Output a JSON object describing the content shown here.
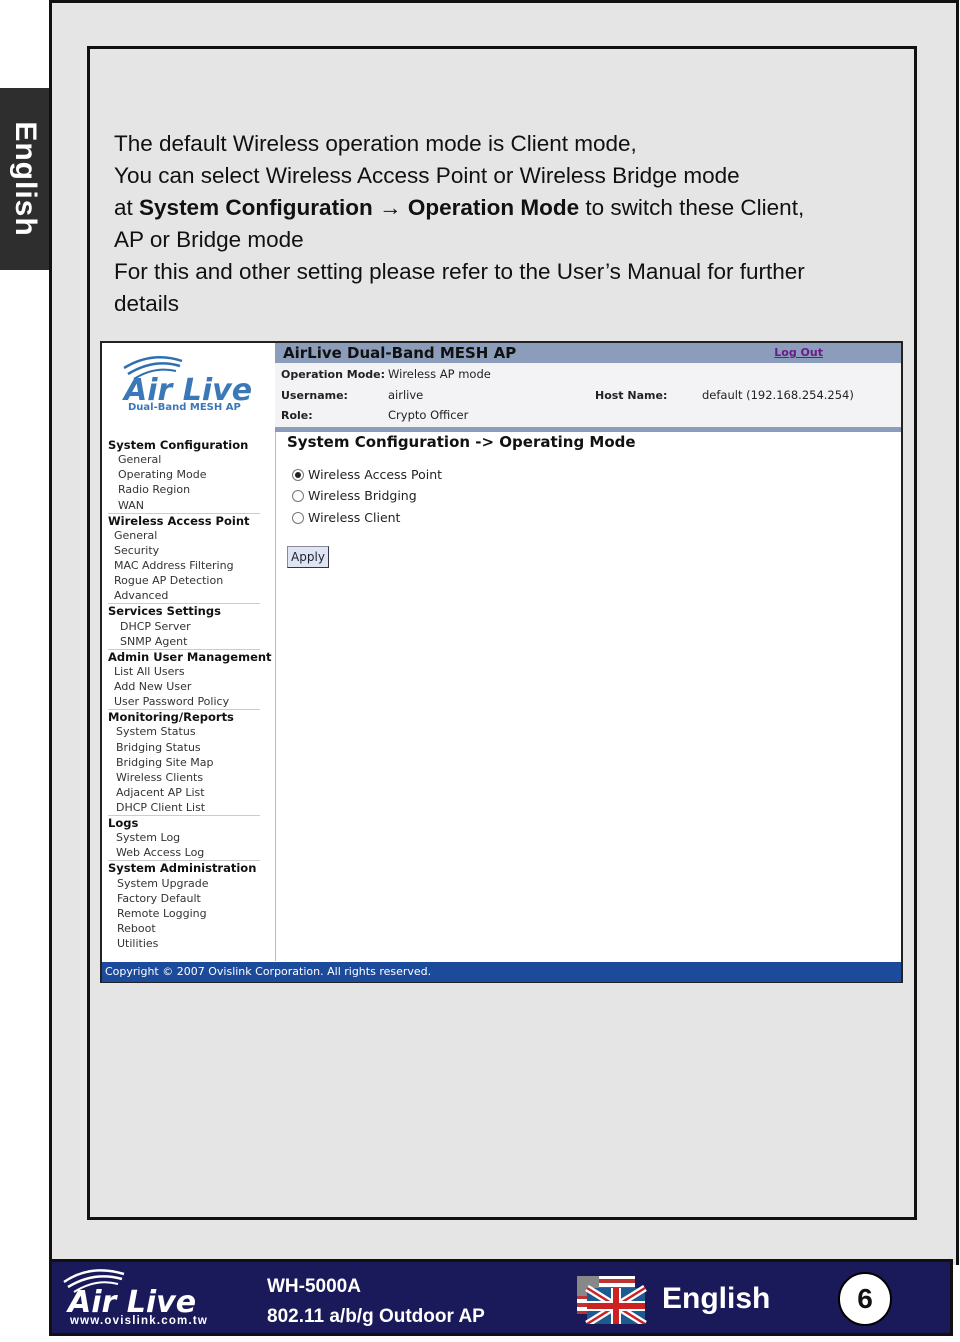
{
  "side_tab": {
    "label": "English"
  },
  "description": {
    "line1": "The default Wireless operation mode is Client mode,",
    "line2": "You can select Wireless Access Point or Wireless Bridge mode",
    "line3_pre": "at ",
    "line3_bold1": "System Configuration",
    "line3_arrow": " → ",
    "line3_bold2": "Operation Mode",
    "line3_post": " to switch these Client,",
    "line4": "AP or Bridge mode",
    "line5": "For this and other setting please refer to the User’s Manual for further",
    "line6": "details"
  },
  "screenshot": {
    "logo": {
      "brand": "Air Live",
      "tagline": "Dual-Band MESH AP"
    },
    "header": {
      "title": "AirLive Dual-Band MESH AP",
      "logout": "Log Out"
    },
    "info": {
      "operation_mode_label": "Operation Mode:",
      "operation_mode_value": "Wireless AP mode",
      "username_label": "Username:",
      "username_value": "airlive",
      "role_label": "Role:",
      "role_value": "Crypto Officer",
      "host_label": "Host Name:",
      "host_value": "default (192.168.254.254)"
    },
    "nav": [
      {
        "group": "System Configuration",
        "items": [
          "General",
          "Operating Mode",
          "Radio Region",
          "WAN"
        ]
      },
      {
        "group": "Wireless Access Point",
        "items": [
          "General",
          "Security",
          "MAC Address Filtering",
          "Rogue AP Detection",
          "Advanced"
        ]
      },
      {
        "group": "Services Settings",
        "items": [
          "DHCP Server",
          "SNMP Agent"
        ]
      },
      {
        "group": "Admin User Management",
        "items": [
          "List All Users",
          "Add New User",
          "User Password Policy"
        ]
      },
      {
        "group": "Monitoring/Reports",
        "items": [
          "System Status",
          "Bridging Status",
          "Bridging Site Map",
          "Wireless Clients",
          "Adjacent AP List",
          "DHCP Client List"
        ]
      },
      {
        "group": "Logs",
        "items": [
          "System Log",
          "Web Access Log"
        ]
      },
      {
        "group": "System Administration",
        "items": [
          "System Upgrade",
          "Factory Default",
          "Remote Logging",
          "Reboot",
          "Utilities"
        ]
      }
    ],
    "content": {
      "title": "System Configuration -> Operating Mode",
      "options": [
        {
          "label": "Wireless Access Point",
          "selected": true
        },
        {
          "label": "Wireless Bridging",
          "selected": false
        },
        {
          "label": "Wireless Client",
          "selected": false
        }
      ],
      "apply": "Apply"
    },
    "copyright": "Copyright © 2007 Ovislink Corporation. All rights reserved."
  },
  "footer": {
    "brand": "Air Live",
    "website": "www.ovislink.com.tw",
    "model": "WH-5000A",
    "product": "802.11 a/b/g Outdoor AP",
    "language": "English",
    "page_number": "6"
  }
}
